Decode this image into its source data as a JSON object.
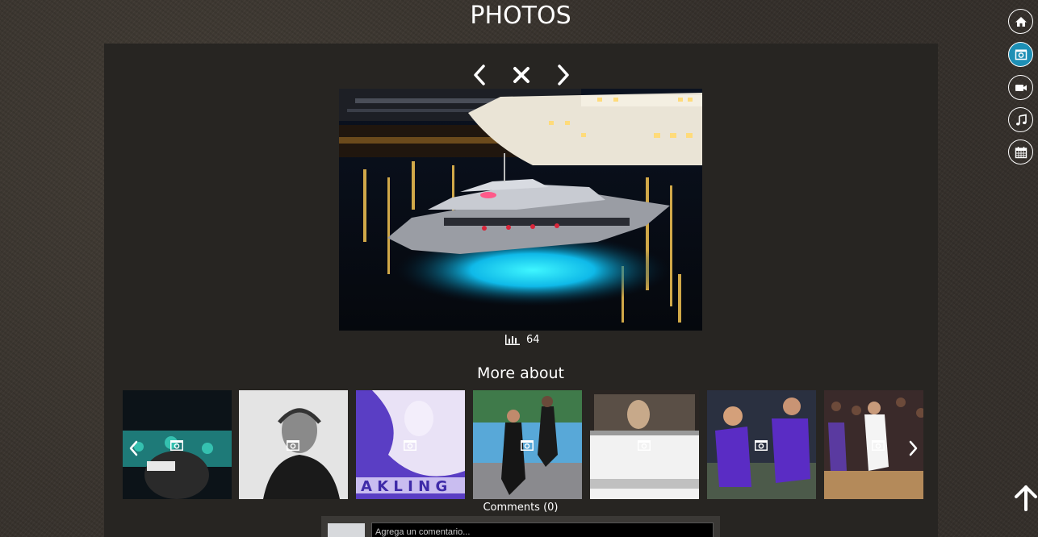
{
  "page": {
    "title": "PHOTOS"
  },
  "viewer": {
    "prev_icon": "chevron-left-icon",
    "close_icon": "close-icon",
    "next_icon": "chevron-right-icon",
    "views_icon": "bar-chart-icon",
    "views": "64"
  },
  "more": {
    "title": "More about",
    "thumbnails": [
      {
        "icon": "camera-icon"
      },
      {
        "icon": "camera-icon"
      },
      {
        "icon": "camera-icon"
      },
      {
        "icon": "camera-icon"
      },
      {
        "icon": "camera-icon"
      },
      {
        "icon": "camera-icon"
      },
      {
        "icon": "camera-icon"
      }
    ]
  },
  "comments": {
    "label": "Comments (0)",
    "placeholder": "Agrega un comentario..."
  },
  "side_nav": {
    "items": [
      {
        "name": "home",
        "icon": "home-icon",
        "active": false
      },
      {
        "name": "photos",
        "icon": "camera-icon",
        "active": true
      },
      {
        "name": "videos",
        "icon": "video-camera-icon",
        "active": false
      },
      {
        "name": "music",
        "icon": "music-note-icon",
        "active": false
      },
      {
        "name": "calendar",
        "icon": "calendar-icon",
        "active": false
      }
    ]
  },
  "colors": {
    "accent": "#1d8fb5",
    "panel": "#272522",
    "background": "#3a352f"
  }
}
